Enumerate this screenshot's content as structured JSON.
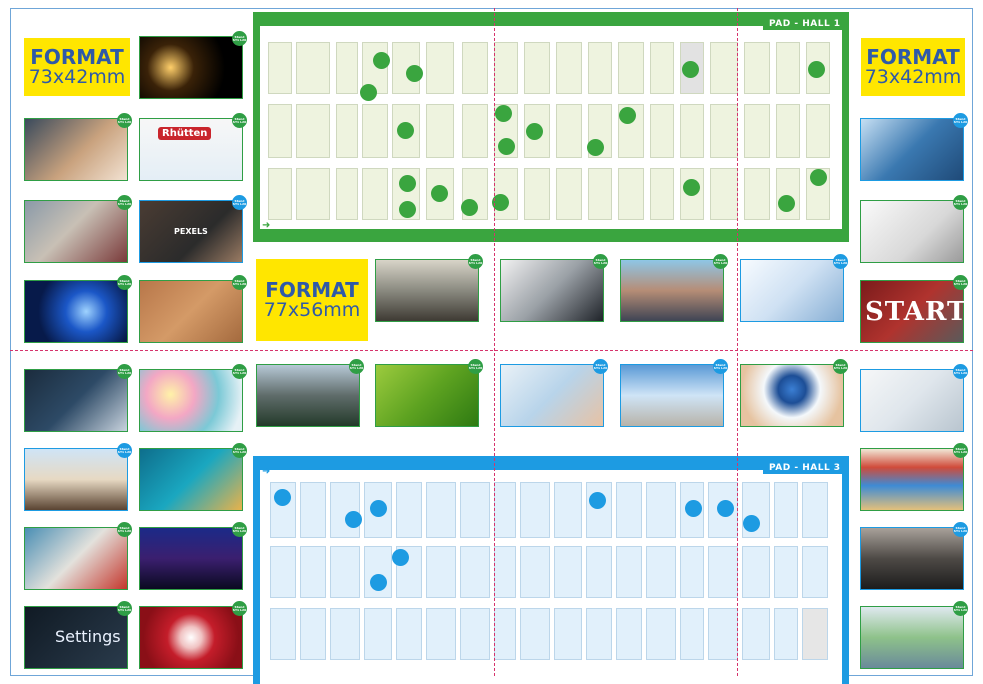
{
  "formats": {
    "left": {
      "title": "FORMAT",
      "size": "73x42mm"
    },
    "right": {
      "title": "FORMAT",
      "size": "73x42mm"
    },
    "center": {
      "title": "FORMAT",
      "size": "77x56mm"
    }
  },
  "halls": {
    "hall1": {
      "label": "PAD - HALL  1",
      "color": "#3aa53f",
      "stand_fill": "#eef3df",
      "arrow": "➜"
    },
    "hall3": {
      "label": "PAD - HALL  3",
      "color": "#1d9be2",
      "stand_fill": "#e1f0fb",
      "arrow": "➜"
    }
  },
  "badge": {
    "text": "Stand\nST1 L20"
  },
  "photo_texts": {
    "settings": "Settings",
    "start": "START",
    "rhutten": "Rhütten",
    "pexels": "PEXELS"
  },
  "colors": {
    "format_yellow": "#ffe600",
    "format_text": "#2f5aa8",
    "green": "#2f9e45",
    "blue": "#1d9be2",
    "dash": "#d6336c"
  }
}
